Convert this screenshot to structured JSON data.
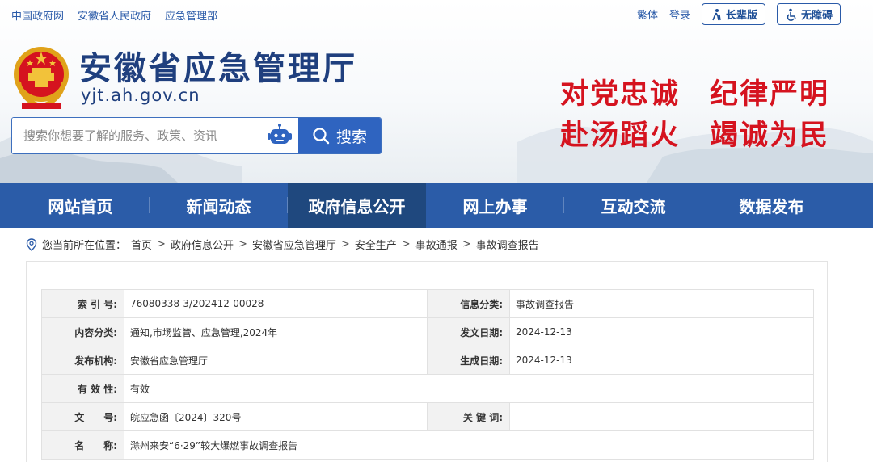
{
  "top_links": [
    "中国政府网",
    "安徽省人民政府",
    "应急管理部"
  ],
  "top_right": {
    "traditional": "繁体",
    "login": "登录",
    "elder_mode": "长辈版",
    "accessibility": "无障碍"
  },
  "site": {
    "title": "安徽省应急管理厅",
    "domain": "yjt.ah.gov.cn"
  },
  "search": {
    "placeholder": "搜索你想要了解的服务、政策、资讯",
    "button": "搜索"
  },
  "slogan": {
    "line1": "对党忠诚　纪律严明",
    "line2": "赴汤蹈火　竭诚为民"
  },
  "nav": {
    "items": [
      "网站首页",
      "新闻动态",
      "政府信息公开",
      "网上办事",
      "互动交流",
      "数据发布"
    ],
    "active": "政府信息公开"
  },
  "breadcrumb": {
    "prefix": "您当前所在位置：",
    "items": [
      "首页",
      "政府信息公开",
      "安徽省应急管理厅",
      "安全生产",
      "事故通报",
      "事故调查报告"
    ],
    "separator": ">"
  },
  "meta": {
    "index_no_label": "索 引 号:",
    "index_no": "76080338-3/202412-00028",
    "info_category_label": "信息分类:",
    "info_category": "事故调查报告",
    "content_category_label": "内容分类:",
    "content_category": "通知,市场监管、应急管理,2024年",
    "publish_date_label": "发文日期:",
    "publish_date": "2024-12-13",
    "issuer_label": "发布机构:",
    "issuer": "安徽省应急管理厅",
    "created_date_label": "生成日期:",
    "created_date": "2024-12-13",
    "validity_label": "有 效 性:",
    "validity": "有效",
    "doc_no_label": "文　　号:",
    "doc_no": "皖应急函〔2024〕320号",
    "keywords_label": "关 键 词:",
    "keywords": "",
    "name_label": "名　　称:",
    "name": "滁州来安“6·29”较大爆燃事故调查报告"
  },
  "colors": {
    "nav_bg": "#2b5ca8",
    "nav_active": "#1f487e",
    "title": "#1f3f7e",
    "slogan": "#d5131f",
    "link": "#2a5aa8"
  }
}
